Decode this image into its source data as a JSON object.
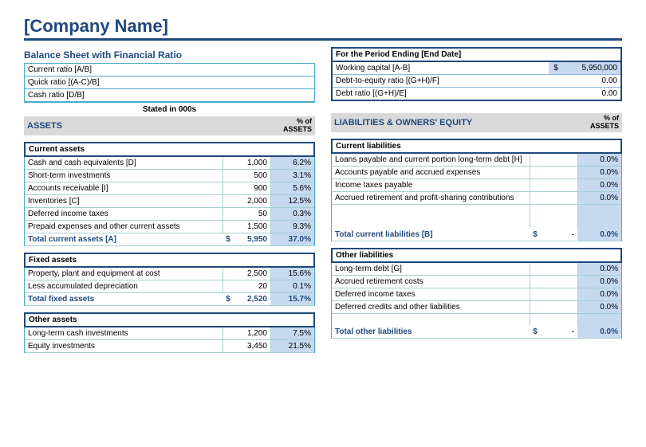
{
  "title": "[Company Name]",
  "subtitle": "Balance Sheet with Financial Ratio",
  "period_label": "For the Period Ending [End Date]",
  "left_ratios": [
    {
      "label": "Current ratio [A/B]",
      "value": ""
    },
    {
      "label": "Quick ratio [(A-C)/B]",
      "value": ""
    },
    {
      "label": "Cash ratio [D/B]",
      "value": ""
    }
  ],
  "right_ratios": [
    {
      "label": "Working capital [A-B]",
      "cur": "$",
      "value": "5,950,000"
    },
    {
      "label": "Debt-to-equity ratio [(G+H)/F]",
      "cur": "",
      "value": "0.00"
    },
    {
      "label": "Debt ratio [(G+H)/E]",
      "cur": "",
      "value": "0.00"
    }
  ],
  "stated": "Stated in 000s",
  "assets_hdr": "ASSETS",
  "pct_assets_hdr": "% of ASSETS",
  "liab_hdr": "LIABILITIES & OWNERS' EQUITY",
  "current_assets_hdr": "Current assets",
  "current_assets": [
    {
      "label": "Cash and cash equivalents [D]",
      "value": "1,000",
      "pct": "6.2%"
    },
    {
      "label": "Short-term investments",
      "value": "500",
      "pct": "3.1%"
    },
    {
      "label": "Accounts receivable [I]",
      "value": "900",
      "pct": "5.6%"
    },
    {
      "label": "Inventories [C]",
      "value": "2,000",
      "pct": "12.5%"
    },
    {
      "label": "Deferred income taxes",
      "value": "50",
      "pct": "0.3%"
    },
    {
      "label": "Prepaid expenses and other current assets",
      "value": "1,500",
      "pct": "9.3%"
    }
  ],
  "total_current_assets": {
    "label": "Total current assets [A]",
    "cur": "$",
    "value": "5,950",
    "pct": "37.0%"
  },
  "fixed_assets_hdr": "Fixed assets",
  "fixed_assets": [
    {
      "label": "Property, plant and equipment at cost",
      "value": "2,500",
      "pct": "15.6%"
    },
    {
      "label": "Less accumulated depreciation",
      "value": "20",
      "pct": "0.1%"
    }
  ],
  "total_fixed_assets": {
    "label": "Total fixed assets",
    "cur": "$",
    "value": "2,520",
    "pct": "15.7%"
  },
  "other_assets_hdr": "Other assets",
  "other_assets": [
    {
      "label": "Long-term cash investments",
      "value": "1,200",
      "pct": "7.5%"
    },
    {
      "label": "Equity investments",
      "value": "3,450",
      "pct": "21.5%"
    }
  ],
  "current_liab_hdr": "Current liabilities",
  "current_liab": [
    {
      "label": "Loans payable and current portion long-term debt [H]",
      "value": "",
      "pct": "0.0%"
    },
    {
      "label": "Accounts payable and accrued expenses",
      "value": "",
      "pct": "0.0%"
    },
    {
      "label": "Income taxes payable",
      "value": "",
      "pct": "0.0%"
    },
    {
      "label": "Accrued retirement and profit-sharing contributions",
      "value": "",
      "pct": "0.0%"
    }
  ],
  "total_current_liab": {
    "label": "Total current liabilities [B]",
    "cur": "$",
    "value": "-",
    "pct": "0.0%"
  },
  "other_liab_hdr": "Other liabilities",
  "other_liab": [
    {
      "label": "Long-term debt [G]",
      "value": "",
      "pct": "0.0%"
    },
    {
      "label": "Accrued retirement costs",
      "value": "",
      "pct": "0.0%"
    },
    {
      "label": "Deferred income taxes",
      "value": "",
      "pct": "0.0%"
    },
    {
      "label": "Deferred credits and other liabilities",
      "value": "",
      "pct": "0.0%"
    }
  ],
  "total_other_liab": {
    "label": "Total other liabilities",
    "cur": "$",
    "value": "-",
    "pct": "0.0%"
  }
}
